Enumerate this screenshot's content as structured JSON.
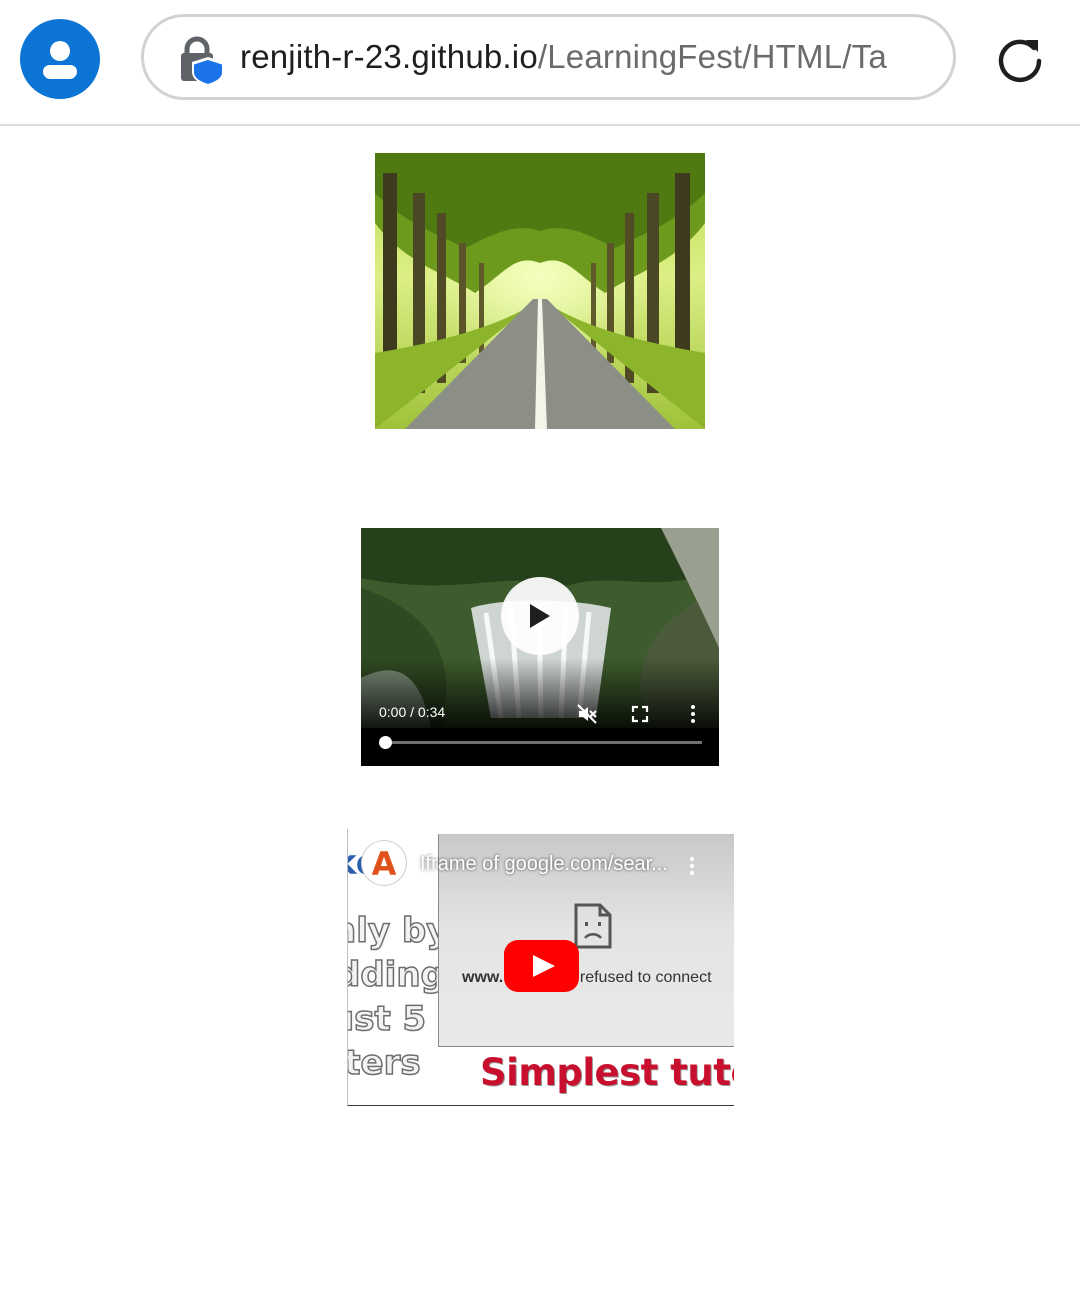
{
  "browser": {
    "url_host": "renjith-r-23.github.io",
    "url_path": "/LearningFest/HTML/Ta",
    "icons": {
      "profile": "account-circle-icon",
      "lock": "lock-shield-icon",
      "reload": "reload-icon"
    },
    "accent_color": "#0b74d4"
  },
  "page": {
    "image": {
      "subject": "tree-lined-road-icon"
    },
    "video": {
      "time_display": "0:00 / 0:34",
      "progress": 0,
      "icons": {
        "play": "play-icon",
        "mute": "muted-icon",
        "fullscreen": "fullscreen-icon",
        "menu": "more-vert-icon"
      }
    },
    "youtube_embed": {
      "title": "Iframe of google.com/sear...",
      "channel_initial": "A",
      "refused_domain_start": "www.",
      "refused_domain_end": "m",
      "refused_text": " refused to connect",
      "thumbnail_lines": [
        "ke !",
        "nly by",
        "dding",
        "ust 5",
        "tters"
      ],
      "tutorial_text": "Simplest tutori",
      "icons": {
        "youtube": "youtube-play-icon",
        "broken": "broken-page-icon",
        "menu": "more-vert-icon"
      },
      "youtube_color": "#ff0000"
    }
  }
}
